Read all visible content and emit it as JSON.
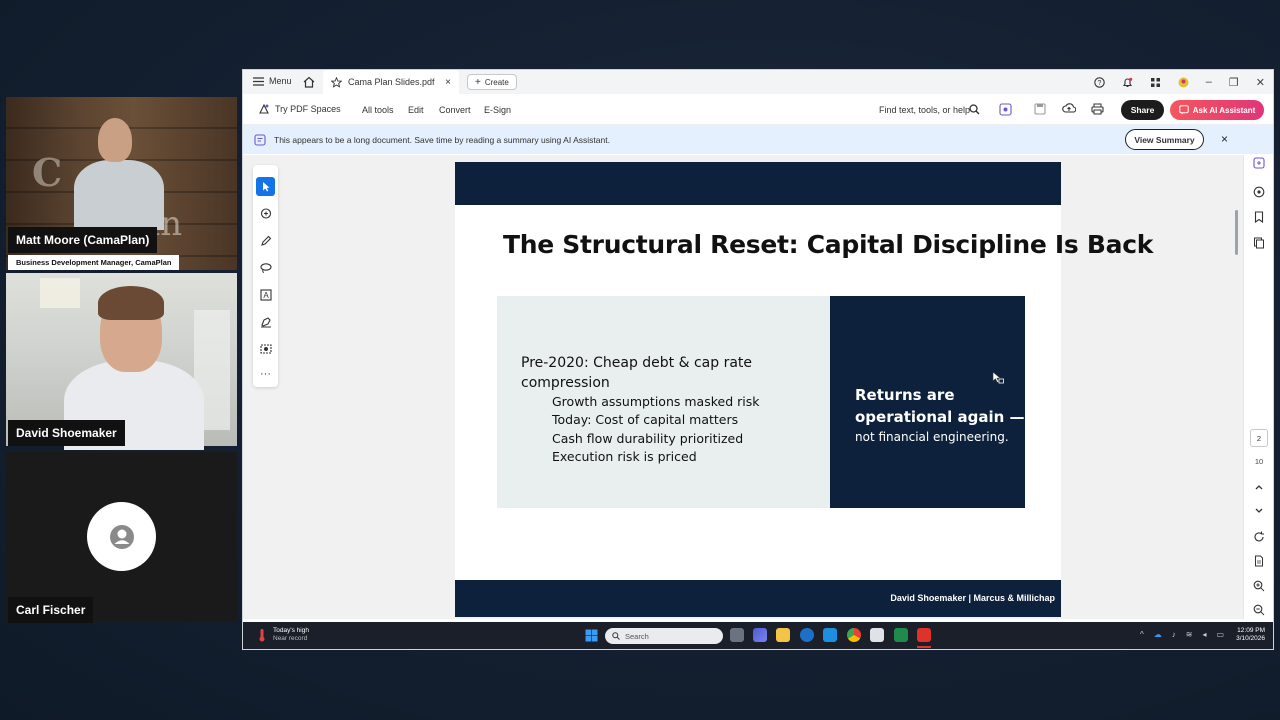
{
  "participants": [
    {
      "name": "Matt Moore (CamaPlan)",
      "role": "Business Development Manager, CamaPlan",
      "backdrop_sign": "C",
      "backdrop_sign2": "an"
    },
    {
      "name": "David Shoemaker"
    },
    {
      "name": "Carl Fischer"
    }
  ],
  "acrobat": {
    "menu_label": "Menu",
    "tab_title": "Cama Plan Slides.pdf",
    "create_label": "Create",
    "toolbar": {
      "try_spaces": "Try PDF Spaces",
      "all_tools": "All tools",
      "edit": "Edit",
      "convert": "Convert",
      "esign": "E-Sign",
      "find_placeholder": "Find text, tools, or help",
      "share": "Share",
      "ask_ai": "Ask AI Assistant"
    },
    "banner": {
      "message": "This appears to be a long document. Save time by reading a summary using AI Assistant.",
      "view_summary": "View Summary"
    },
    "page_nav": {
      "current_page": "2",
      "total_pages": "10"
    }
  },
  "slide": {
    "title": "The Structural Reset: Capital Discipline Is Back",
    "main_bullet": "Pre-2020: Cheap debt & cap rate compression",
    "sub_bullets": [
      "Growth assumptions masked risk",
      "Today: Cost of capital matters",
      "Cash flow durability prioritized",
      "Execution risk is priced"
    ],
    "callout_line1": "Returns are",
    "callout_line2": "operational again —",
    "callout_sub": "not financial engineering.",
    "footer": "David Shoemaker | Marcus & Millichap",
    "colors": {
      "navy": "#0e213c",
      "panel": "#e9efef"
    }
  },
  "taskbar": {
    "weather_line1": "Today's high",
    "weather_line2": "Near record",
    "search_placeholder": "Search",
    "time": "12:09 PM",
    "date": "3/10/2026"
  }
}
